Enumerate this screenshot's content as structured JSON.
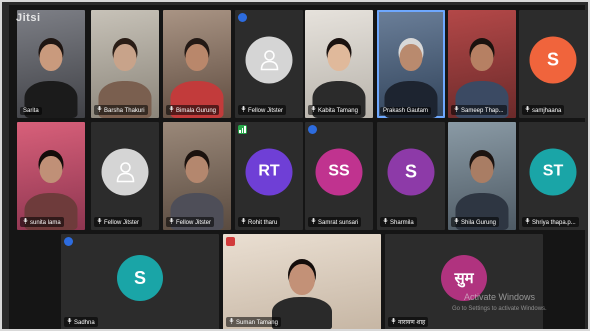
{
  "app": {
    "logo": "Jitsi"
  },
  "participants": [
    {
      "name": "Sarita",
      "type": "video",
      "mic": false
    },
    {
      "name": "Barsha Thakuri",
      "type": "video",
      "mic": true
    },
    {
      "name": "Bimala Gurung",
      "type": "video",
      "mic": true
    },
    {
      "name": "Fellow Jitster",
      "type": "avatar-default",
      "mic": true,
      "indicator": "blue"
    },
    {
      "name": "Kabita Tamang",
      "type": "video",
      "mic": true
    },
    {
      "name": "Prakash Gautam",
      "type": "video",
      "mic": false,
      "active": true
    },
    {
      "name": "Sameep Thap...",
      "type": "video",
      "mic": true
    },
    {
      "name": "samjhaana",
      "type": "avatar",
      "initials": "S",
      "color": "#f0643c",
      "mic": true
    },
    {
      "name": "sunita lama",
      "type": "video",
      "mic": true
    },
    {
      "name": "Fellow Jitster",
      "type": "avatar-default",
      "mic": true
    },
    {
      "name": "Fellow Jitster",
      "type": "video",
      "mic": true
    },
    {
      "name": "Rohit tharu",
      "type": "avatar",
      "initials": "RT",
      "color": "#6f3fd6",
      "mic": true,
      "indicator": "green"
    },
    {
      "name": "Samrat sunsari",
      "type": "avatar",
      "initials": "SS",
      "color": "#c0338f",
      "mic": true,
      "indicator": "blue"
    },
    {
      "name": "Sharmila",
      "type": "avatar",
      "initials": "S",
      "color": "#8d3aa8",
      "mic": true
    },
    {
      "name": "Shila Gurung",
      "type": "video",
      "mic": true
    },
    {
      "name": "Shriya thapa.p...",
      "type": "avatar",
      "initials": "ST",
      "color": "#1aa5a7",
      "mic": true
    },
    {
      "name": "Sadhna",
      "type": "avatar",
      "initials": "S",
      "color": "#1aa5a7",
      "mic": true,
      "indicator": "blue"
    },
    {
      "name": "Suman Tamang",
      "type": "video",
      "mic": true,
      "indicator": "red"
    },
    {
      "name": "नारायण शाह",
      "type": "avatar",
      "initials": "सुम",
      "color": "#b0337f",
      "mic": true
    }
  ],
  "windows_watermark": {
    "title": "Activate Windows",
    "subtitle": "Go to Settings to activate Windows."
  }
}
